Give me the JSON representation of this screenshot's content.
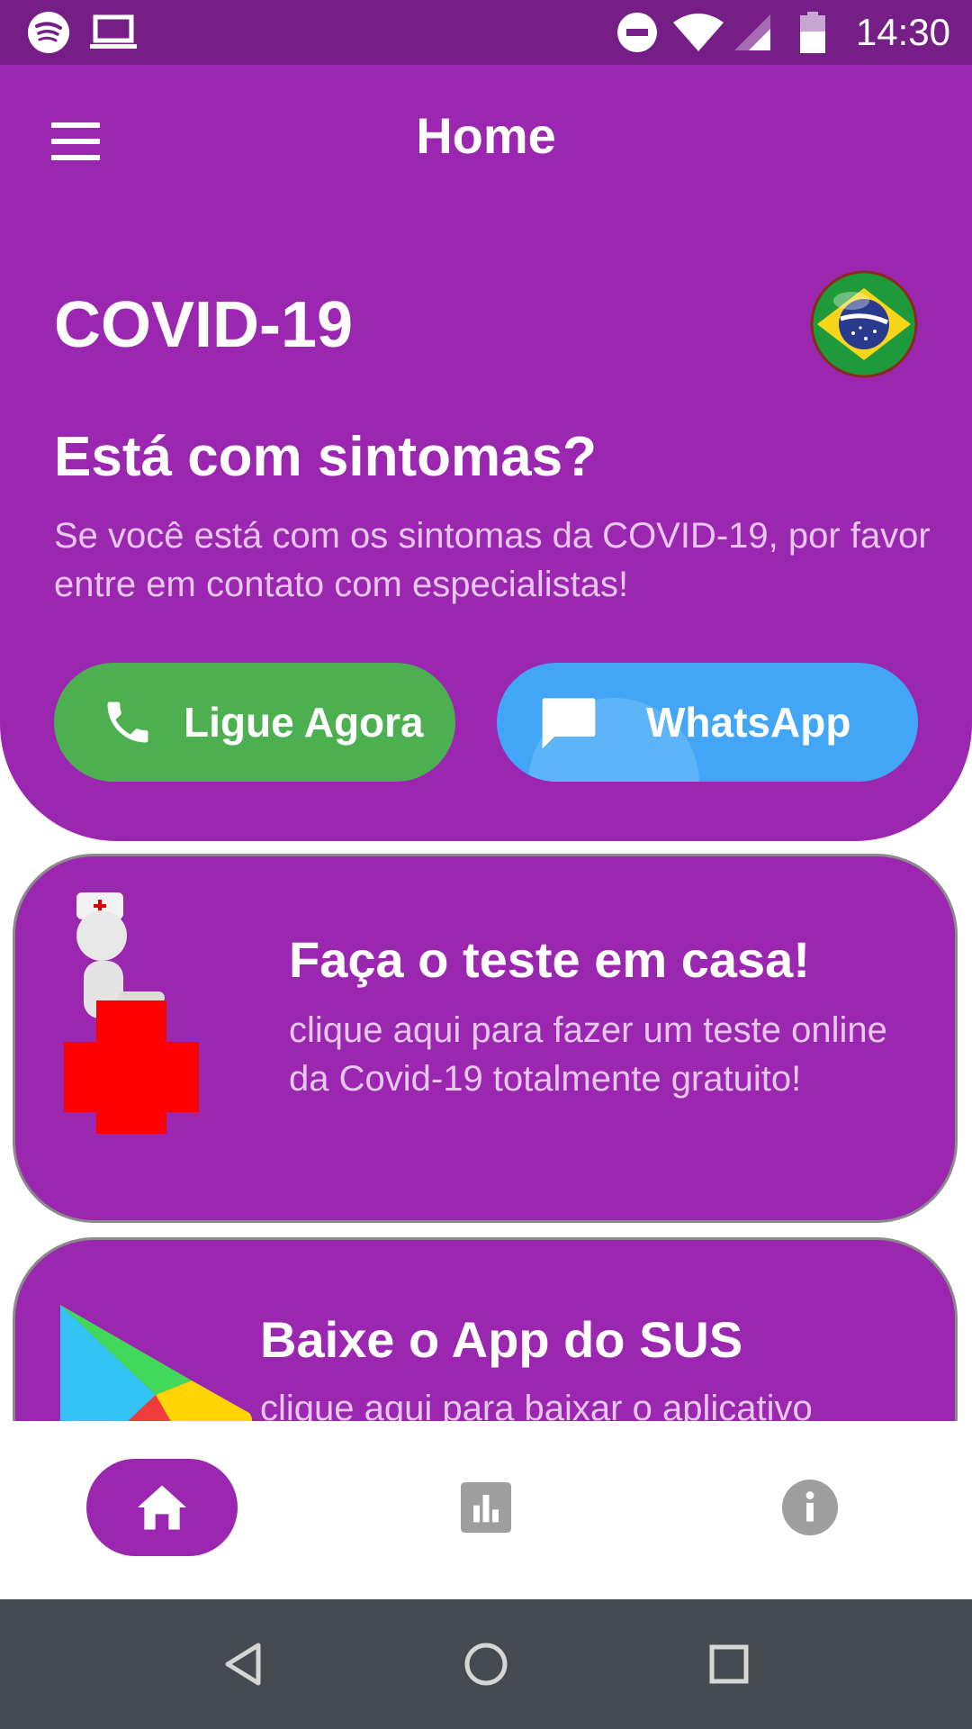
{
  "status_bar": {
    "time": "14:30",
    "icons": [
      "spotify-icon",
      "laptop-icon",
      "do-not-disturb-icon",
      "wifi-icon",
      "signal-icon",
      "battery-icon"
    ]
  },
  "header": {
    "title": "Home",
    "menu_icon": "hamburger-menu-icon"
  },
  "hero": {
    "heading": "COVID-19",
    "flag_icon": "brazil-flag-icon",
    "question": "Está com sintomas?",
    "description": "Se você está com os sintomas da COVID-19, por favor entre em contato com especialistas!",
    "call_button": "Ligue Agora",
    "whatsapp_button": "WhatsApp"
  },
  "cards": [
    {
      "title": "Faça o teste em casa!",
      "text": "clique aqui para fazer um teste online da Covid-19 totalmente gratuito!",
      "icon": "nurse-red-cross-icon"
    },
    {
      "title": "Baixe o App do SUS",
      "text": "clique aqui para baixar o aplicativo",
      "icon": "google-play-icon"
    }
  ],
  "bottom_nav": {
    "items": [
      "home-icon",
      "bar-chart-icon",
      "info-icon"
    ],
    "active": "home-icon"
  },
  "system_nav": [
    "back-icon",
    "home-circle-icon",
    "recents-icon"
  ],
  "colors": {
    "primary": "#9b27b0",
    "status_bar": "#751f86",
    "call_green": "#4caf50",
    "whatsapp_blue": "#42a5f5",
    "system_nav": "#454a50"
  }
}
